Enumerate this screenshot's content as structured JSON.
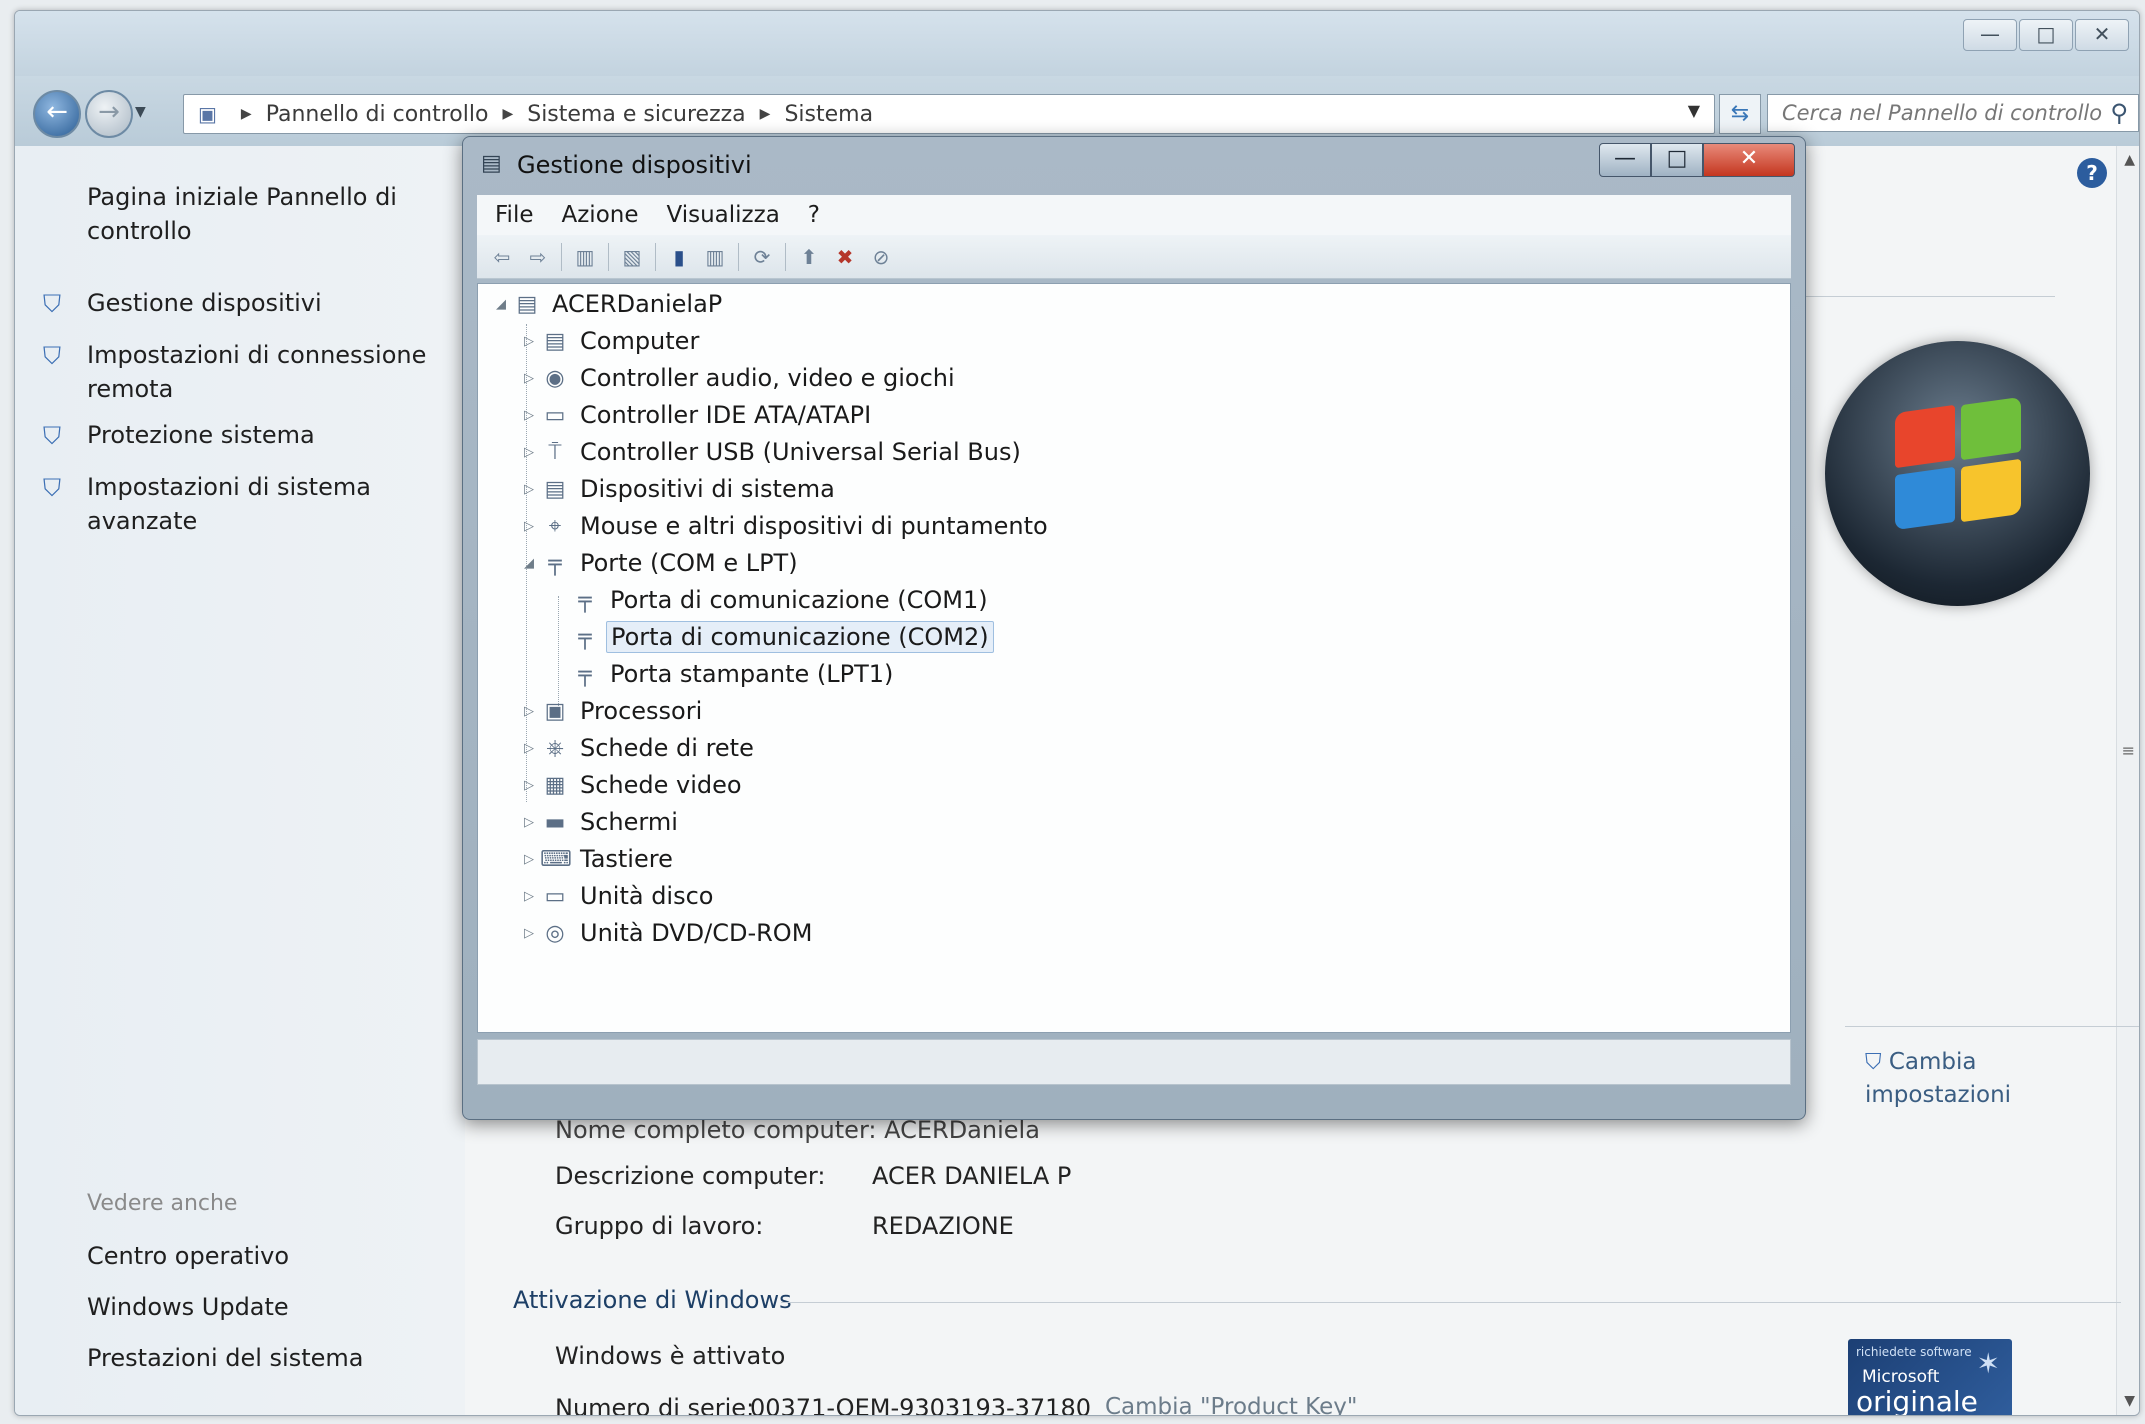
{
  "window": {
    "controls": {
      "minimize": "—",
      "maximize": "□",
      "close": "✕"
    }
  },
  "address": {
    "crumbs": [
      "Pannello di controllo",
      "Sistema e sicurezza",
      "Sistema"
    ],
    "search_placeholder": "Cerca nel Pannello di controllo"
  },
  "sidebar": {
    "home_link": "Pagina iniziale Pannello di controllo",
    "links": [
      "Gestione dispositivi",
      "Impostazioni di connessione remota",
      "Protezione sistema",
      "Impostazioni di sistema avanzate"
    ],
    "see_also_header": "Vedere anche",
    "see_also": [
      "Centro operativo",
      "Windows Update",
      "Prestazioni del sistema"
    ]
  },
  "main": {
    "partially_hidden_row": "Nome completo computer: ACERDaniela",
    "computer_description_label": "Descrizione computer:",
    "computer_description_value": "ACER DANIELA P",
    "workgroup_label": "Gruppo di lavoro:",
    "workgroup_value": "REDAZIONE",
    "change_settings": "Cambia impostazioni",
    "activation_title": "Attivazione di Windows",
    "activation_status": "Windows è attivato",
    "serial_label": "Numero di serie:",
    "serial_value": "00371-OEM-9303193-37180",
    "change_key": "Cambia \"Product Key\"",
    "genuine_badge": {
      "line1": "richiedete software",
      "line2": "Microsoft",
      "line3": "originale"
    }
  },
  "device_manager": {
    "title": "Gestione dispositivi",
    "menu": [
      "File",
      "Azione",
      "Visualizza",
      "?"
    ],
    "tree": {
      "root": "ACERDanielaP",
      "categories": [
        "Computer",
        "Controller audio, video e giochi",
        "Controller IDE ATA/ATAPI",
        "Controller USB (Universal Serial Bus)",
        "Dispositivi di sistema",
        "Mouse e altri dispositivi di puntamento",
        "Porte (COM e LPT)",
        "Processori",
        "Schede di rete",
        "Schede video",
        "Schermi",
        "Tastiere",
        "Unità disco",
        "Unità DVD/CD-ROM"
      ],
      "ports_children": [
        "Porta di comunicazione (COM1)",
        "Porta di comunicazione (COM2)",
        "Porta stampante (LPT1)"
      ],
      "selected": "Porta di comunicazione (COM2)"
    }
  }
}
